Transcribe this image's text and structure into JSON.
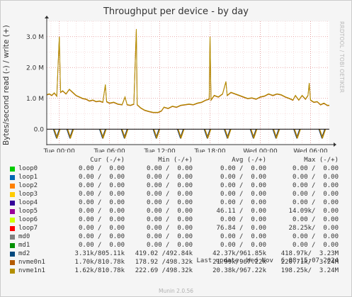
{
  "title": "Throughput per device - by day",
  "watermark": "RRDTOOL / TOBI OETIKER",
  "footer": "Munin 2.0.56",
  "last_update": "Last update: Wed Nov  6 08:15:07 2024",
  "legend_headers": [
    "Cur (-/+)",
    "Min (-/+)",
    "Avg (-/+)",
    "Max (-/+)"
  ],
  "legend": [
    {
      "name": "loop0",
      "color": "#00cc00",
      "cur": "0.00 /  0.00",
      "min": "0.00 /  0.00",
      "avg": "0.00 /  0.00",
      "max": "0.00 /  0.00"
    },
    {
      "name": "loop1",
      "color": "#0066b3",
      "cur": "0.00 /  0.00",
      "min": "0.00 /  0.00",
      "avg": "0.00 /  0.00",
      "max": "0.00 /  0.00"
    },
    {
      "name": "loop2",
      "color": "#ff8000",
      "cur": "0.00 /  0.00",
      "min": "0.00 /  0.00",
      "avg": "0.00 /  0.00",
      "max": "0.00 /  0.00"
    },
    {
      "name": "loop3",
      "color": "#ffcc00",
      "cur": "0.00 /  0.00",
      "min": "0.00 /  0.00",
      "avg": "0.00 /  0.00",
      "max": "0.00 /  0.00"
    },
    {
      "name": "loop4",
      "color": "#330099",
      "cur": "0.00 /  0.00",
      "min": "0.00 /  0.00",
      "avg": "0.00 /  0.00",
      "max": "0.00 /  0.00"
    },
    {
      "name": "loop5",
      "color": "#990099",
      "cur": "0.00 /  0.00",
      "min": "0.00 /  0.00",
      "avg": "46.11 /  0.00",
      "max": "14.09k/  0.00"
    },
    {
      "name": "loop6",
      "color": "#ccff00",
      "cur": "0.00 /  0.00",
      "min": "0.00 /  0.00",
      "avg": "0.00 /  0.00",
      "max": "0.00 /  0.00"
    },
    {
      "name": "loop7",
      "color": "#ff0000",
      "cur": "0.00 /  0.00",
      "min": "0.00 /  0.00",
      "avg": "76.84 /  0.00",
      "max": "28.25k/  0.00"
    },
    {
      "name": "md0",
      "color": "#808080",
      "cur": "0.00 /  0.00",
      "min": "0.00 /  0.00",
      "avg": "0.00 /  0.00",
      "max": "0.00 /  0.00"
    },
    {
      "name": "md1",
      "color": "#008f00",
      "cur": "0.00 /  0.00",
      "min": "0.00 /  0.00",
      "avg": "0.00 /  0.00",
      "max": "0.00 /  0.00"
    },
    {
      "name": "md2",
      "color": "#00487d",
      "cur": "3.31k/805.11k",
      "min": "419.02 /492.84k",
      "avg": "42.37k/961.85k",
      "max": "418.97k/  3.23M"
    },
    {
      "name": "nvme0n1",
      "color": "#b35a00",
      "cur": "1.70k/810.78k",
      "min": "178.92 /498.32k",
      "avg": "21.99k/967.22k",
      "max": "220.71k/  3.24M"
    },
    {
      "name": "nvme1n1",
      "color": "#b38f00",
      "cur": "1.62k/810.78k",
      "min": "222.69 /498.32k",
      "avg": "20.38k/967.22k",
      "max": "198.25k/  3.24M"
    }
  ],
  "chart_data": {
    "type": "line",
    "title": "Throughput per device - by day",
    "ylabel": "Bytes/second read (-) / write (+)",
    "ylim": [
      -500000,
      3500000
    ],
    "y_ticks": [
      {
        "value": 3000000,
        "label": "3.0 M"
      },
      {
        "value": 2000000,
        "label": "2.0 M"
      },
      {
        "value": 1000000,
        "label": "1.0 M"
      },
      {
        "value": 0,
        "label": "0.0"
      }
    ],
    "x_range_hours": [
      -1.5,
      32.25
    ],
    "x_ticks": [
      {
        "value": 0,
        "label": "Tue 00:00"
      },
      {
        "value": 6,
        "label": "Tue 06:00"
      },
      {
        "value": 12,
        "label": "Tue 12:00"
      },
      {
        "value": 18,
        "label": "Tue 18:00"
      },
      {
        "value": 24,
        "label": "Wed 00:00"
      },
      {
        "value": 30,
        "label": "Wed 06:00"
      }
    ],
    "grid": true,
    "write_series": {
      "name": "nvme1n1",
      "color": "#b38f00",
      "points": [
        [
          -1.5,
          1.12
        ],
        [
          -1.2,
          1.15
        ],
        [
          -0.9,
          1.1
        ],
        [
          -0.6,
          1.18
        ],
        [
          -0.3,
          1.08
        ],
        [
          0.0,
          3.0
        ],
        [
          0.15,
          1.2
        ],
        [
          0.4,
          1.25
        ],
        [
          0.8,
          1.15
        ],
        [
          1.2,
          1.3
        ],
        [
          1.6,
          1.2
        ],
        [
          2.0,
          1.1
        ],
        [
          2.4,
          1.05
        ],
        [
          2.8,
          1.0
        ],
        [
          3.2,
          0.98
        ],
        [
          3.6,
          0.92
        ],
        [
          4.0,
          0.95
        ],
        [
          4.4,
          0.9
        ],
        [
          4.8,
          0.92
        ],
        [
          5.2,
          0.88
        ],
        [
          5.5,
          1.45
        ],
        [
          5.65,
          0.9
        ],
        [
          6.0,
          0.85
        ],
        [
          6.5,
          0.88
        ],
        [
          7.0,
          0.82
        ],
        [
          7.5,
          0.8
        ],
        [
          7.85,
          1.05
        ],
        [
          8.1,
          0.8
        ],
        [
          8.5,
          0.78
        ],
        [
          8.9,
          0.82
        ],
        [
          9.2,
          3.25
        ],
        [
          9.3,
          0.8
        ],
        [
          9.7,
          0.7
        ],
        [
          10.2,
          0.62
        ],
        [
          10.7,
          0.58
        ],
        [
          11.2,
          0.55
        ],
        [
          11.8,
          0.55
        ],
        [
          12.2,
          0.6
        ],
        [
          12.5,
          0.72
        ],
        [
          13.0,
          0.68
        ],
        [
          13.5,
          0.75
        ],
        [
          14.0,
          0.72
        ],
        [
          14.5,
          0.78
        ],
        [
          15.0,
          0.8
        ],
        [
          15.5,
          0.82
        ],
        [
          16.0,
          0.8
        ],
        [
          16.5,
          0.85
        ],
        [
          17.0,
          0.88
        ],
        [
          17.5,
          0.95
        ],
        [
          17.9,
          0.98
        ],
        [
          18.0,
          3.0
        ],
        [
          18.12,
          0.95
        ],
        [
          18.5,
          1.1
        ],
        [
          19.0,
          1.05
        ],
        [
          19.5,
          1.15
        ],
        [
          19.9,
          1.55
        ],
        [
          20.05,
          1.1
        ],
        [
          20.5,
          1.2
        ],
        [
          21.0,
          1.15
        ],
        [
          21.5,
          1.1
        ],
        [
          22.0,
          1.05
        ],
        [
          22.5,
          1.0
        ],
        [
          23.0,
          1.02
        ],
        [
          23.5,
          0.98
        ],
        [
          24.0,
          1.05
        ],
        [
          24.5,
          1.08
        ],
        [
          25.0,
          1.15
        ],
        [
          25.5,
          1.1
        ],
        [
          26.0,
          1.15
        ],
        [
          26.5,
          1.12
        ],
        [
          27.0,
          1.05
        ],
        [
          27.5,
          1.0
        ],
        [
          27.9,
          0.95
        ],
        [
          28.2,
          1.1
        ],
        [
          28.6,
          0.95
        ],
        [
          29.0,
          1.1
        ],
        [
          29.4,
          0.98
        ],
        [
          29.7,
          1.1
        ],
        [
          29.85,
          1.5
        ],
        [
          30.0,
          0.95
        ],
        [
          30.4,
          0.88
        ],
        [
          30.8,
          0.9
        ],
        [
          31.2,
          0.8
        ],
        [
          31.6,
          0.85
        ],
        [
          32.0,
          0.78
        ],
        [
          32.25,
          0.78
        ]
      ]
    },
    "read_spike_hours": [
      -0.3,
      1.3,
      5.2,
      7.8,
      11.6,
      14.5,
      17.7,
      20.1,
      23.2,
      25.9,
      28.4,
      31.4
    ],
    "read_spike_depth": -0.28,
    "read_series_names": [
      "md2",
      "nvme0n1",
      "nvme1n1"
    ]
  }
}
